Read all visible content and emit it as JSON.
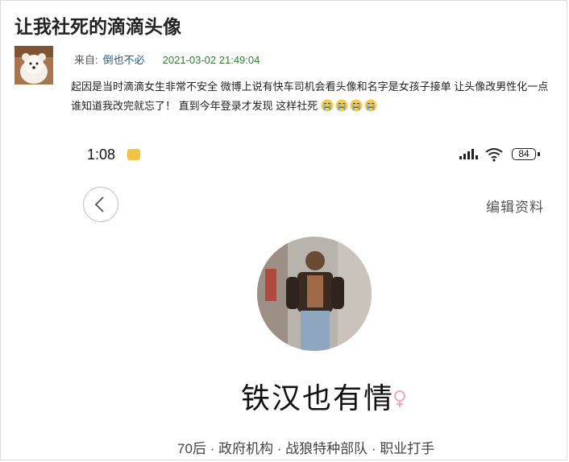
{
  "post": {
    "title": "让我社死的滴滴头像",
    "from_label": "来自:",
    "author": "倒也不必",
    "timestamp": "2021-03-02 21:49:04",
    "text": "起因是当时滴滴女生非常不安全 微博上说有快车司机会看头像和名字是女孩子接单 让头像改男性化一点 谁知道我改完就忘了！ 直到今年登录才发现 这样社死",
    "emoji": "crying-face-icon",
    "emoji_count": 4
  },
  "phone": {
    "status_time": "1:08",
    "battery": "84",
    "edit_profile_label": "编辑资料",
    "nickname": "铁汉也有情",
    "gender_icon": "female-symbol-icon",
    "gender_color": "#f4a6c0",
    "bio": "70后 · 政府机构 · 战狼特种部队 · 职业打手"
  }
}
